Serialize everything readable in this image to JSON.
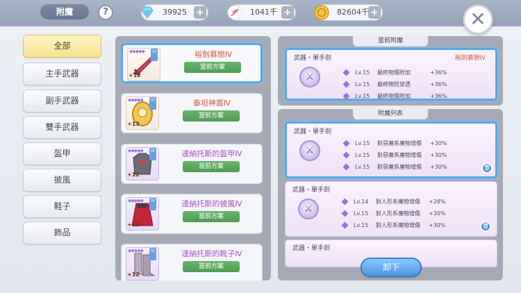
{
  "header": {
    "title": "附魔",
    "help": "?"
  },
  "resources": [
    {
      "name": "gem",
      "value": "39925",
      "icon": "diamond-icon",
      "color": "#7fd3f0"
    },
    {
      "name": "stamina",
      "value": "1041千",
      "icon": "feather-icon",
      "color": "#e7849b"
    },
    {
      "name": "gold",
      "value": "82604千",
      "icon": "coin-icon",
      "color": "#f2b93b"
    }
  ],
  "plus_label": "+",
  "close_label": "✕",
  "sidebar": {
    "items": [
      {
        "label": "全部",
        "active": true
      },
      {
        "label": "主手武器"
      },
      {
        "label": "副手武器"
      },
      {
        "label": "雙手武器"
      },
      {
        "label": "盔甲"
      },
      {
        "label": "披風"
      },
      {
        "label": "鞋子"
      },
      {
        "label": "飾品"
      }
    ]
  },
  "equipment": [
    {
      "name": "裕劍慕戀Ⅳ",
      "plan": "當前方案",
      "plus": "+12",
      "lvl": "IV"
    },
    {
      "name": "泰坦神盾Ⅳ",
      "plan": "當前方案",
      "plus": "+13",
      "lvl": "IV"
    },
    {
      "name": "達納托斯的盔甲Ⅳ",
      "plan": "當前方案",
      "plus": "+12",
      "lvl": "IV"
    },
    {
      "name": "達納托斯的披風Ⅳ",
      "plan": "當前方案",
      "plus": "+12",
      "lvl": "IV"
    },
    {
      "name": "達納托斯的靴子Ⅳ",
      "plan": "當前方案",
      "plus": "+12",
      "lvl": "IV"
    }
  ],
  "current": {
    "header": "當前附魔",
    "category": "武器・單手劍",
    "weapon": "裕劍慕戀Ⅳ",
    "rows": [
      {
        "lv": "Lv.15",
        "effect": "最終物傷附加",
        "pct": "+36%"
      },
      {
        "lv": "Lv.15",
        "effect": "最終物防穿透",
        "pct": "+36%"
      },
      {
        "lv": "Lv.15",
        "effect": "最終物傷附加",
        "pct": "+36%"
      }
    ]
  },
  "list": {
    "header": "附魔列表",
    "entries": [
      {
        "category": "武器・單手劍",
        "rows": [
          {
            "lv": "Lv.15",
            "effect": "對惡魔系魔物增傷",
            "pct": "+30%"
          },
          {
            "lv": "Lv.15",
            "effect": "對惡魔系魔物增傷",
            "pct": "+30%"
          },
          {
            "lv": "Lv.15",
            "effect": "對惡魔系魔物增傷",
            "pct": "+30%"
          }
        ]
      },
      {
        "category": "武器・單手劍",
        "rows": [
          {
            "lv": "Lv.14",
            "effect": "對人形系魔物增傷",
            "pct": "+28%"
          },
          {
            "lv": "Lv.15",
            "effect": "對人形系魔物增傷",
            "pct": "+30%"
          },
          {
            "lv": "Lv.15",
            "effect": "對人形系魔物增傷",
            "pct": "+30%"
          }
        ]
      },
      {
        "category": "武器・單手劍",
        "rows": []
      }
    ]
  },
  "unload_button": "卸下"
}
